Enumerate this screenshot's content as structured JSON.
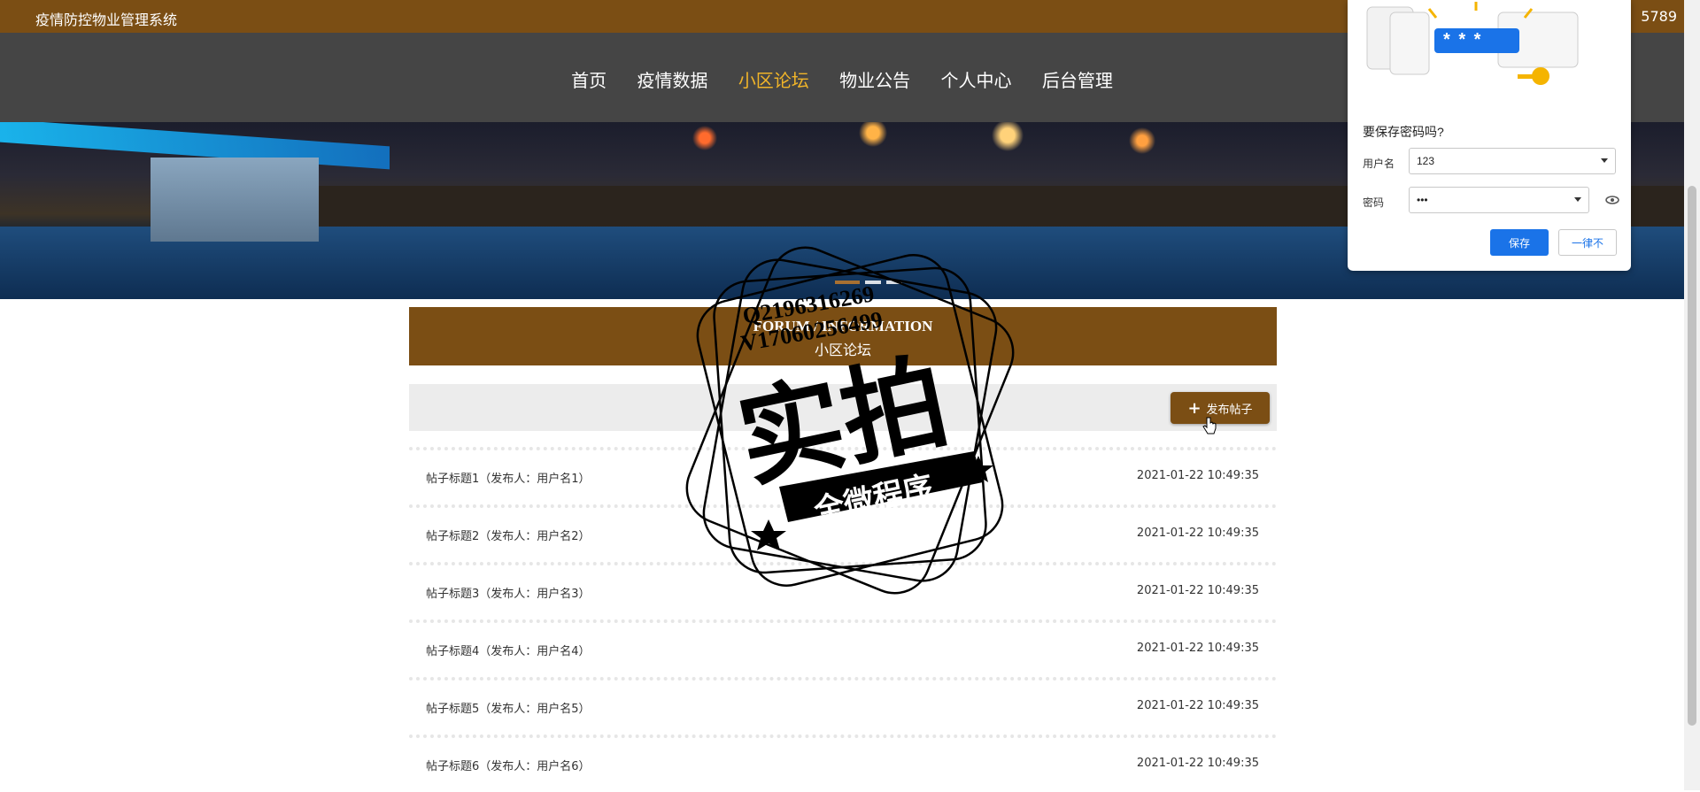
{
  "topbar": {
    "system_title": "疫情防控物业管理系统",
    "phone_fragment": "5789"
  },
  "nav": {
    "items": [
      "首页",
      "疫情数据",
      "小区论坛",
      "物业公告",
      "个人中心",
      "后台管理"
    ],
    "active_index": 2
  },
  "section": {
    "title_en": "FORUM / INFORMATION",
    "title_cn": "小区论坛"
  },
  "toolbar": {
    "post_button_label": "发布帖子"
  },
  "posts": [
    {
      "title": "帖子标题1（发布人：用户名1）",
      "date": "2021-01-22 10:49:35"
    },
    {
      "title": "帖子标题2（发布人：用户名2）",
      "date": "2021-01-22 10:49:35"
    },
    {
      "title": "帖子标题3（发布人：用户名3）",
      "date": "2021-01-22 10:49:35"
    },
    {
      "title": "帖子标题4（发布人：用户名4）",
      "date": "2021-01-22 10:49:35"
    },
    {
      "title": "帖子标题5（发布人：用户名5）",
      "date": "2021-01-22 10:49:35"
    },
    {
      "title": "帖子标题6（发布人：用户名6）",
      "date": "2021-01-22 10:49:35"
    }
  ],
  "watermark": {
    "line1": "Q2196316269",
    "line2": "V17060256499",
    "big": "实拍",
    "banner": "全微程序"
  },
  "password_popup": {
    "question": "要保存密码吗?",
    "username_label": "用户名",
    "username_value": "123",
    "password_label": "密码",
    "password_value": "•••",
    "save_label": "保存",
    "never_label": "一律不",
    "illustration_mask": "* * *"
  },
  "colors": {
    "brand": "#7b4e14",
    "nav_bg": "#454545",
    "active_nav": "#f0b429",
    "primary_blue": "#1a73e8"
  }
}
